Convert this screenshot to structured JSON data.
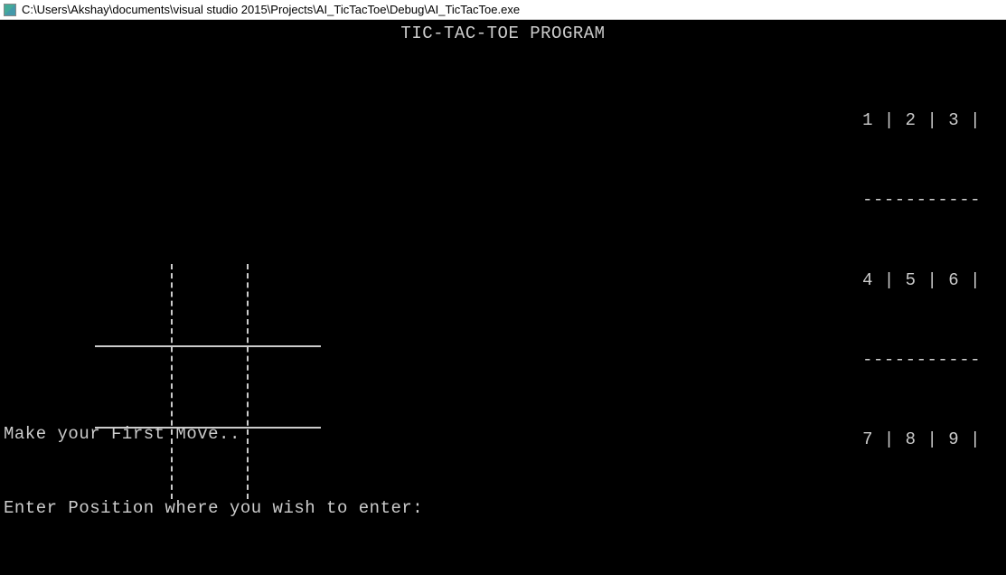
{
  "window": {
    "title": "C:\\Users\\Akshay\\documents\\visual studio 2015\\Projects\\AI_TicTacToe\\Debug\\AI_TicTacToe.exe"
  },
  "console": {
    "title": "TIC-TAC-TOE PROGRAM",
    "legend": {
      "row1": "1 | 2 | 3 |",
      "divider1": "-----------",
      "row2": "4 | 5 | 6 |",
      "divider2": "-----------",
      "row3": "7 | 8 | 9 |"
    },
    "prompts": {
      "line1": "Make your First Move..",
      "line2": "Enter Position where you wish to enter:"
    }
  }
}
